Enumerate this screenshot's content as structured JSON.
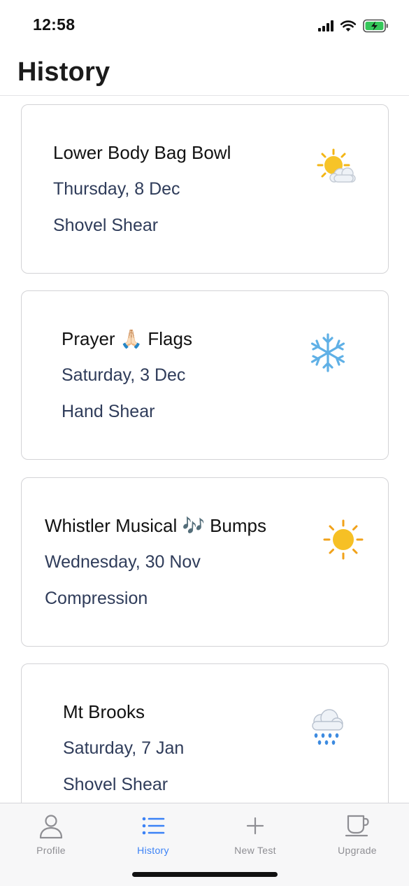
{
  "status": {
    "time": "12:58",
    "icons": [
      "cellular-signal-icon",
      "wifi-icon",
      "battery-charging-icon"
    ]
  },
  "header": {
    "title": "History"
  },
  "history": {
    "items": [
      {
        "title": "Lower Body Bag Bowl",
        "date": "Thursday, 8 Dec",
        "type": "Shovel Shear",
        "weather_icon": "sun-behind-cloud-icon"
      },
      {
        "title": "Prayer 🙏🏻 Flags",
        "date": "Saturday, 3 Dec",
        "type": "Hand Shear",
        "weather_icon": "snowflake-icon"
      },
      {
        "title": "Whistler Musical 🎶 Bumps",
        "date": "Wednesday, 30 Nov",
        "type": "Compression",
        "weather_icon": "sun-icon"
      },
      {
        "title": "Mt Brooks",
        "date": "Saturday, 7 Jan",
        "type": "Shovel Shear",
        "weather_icon": "cloud-with-rain-icon"
      }
    ]
  },
  "tabbar": {
    "tabs": [
      {
        "label": "Profile",
        "icon": "person-icon",
        "active": false
      },
      {
        "label": "History",
        "icon": "list-icon",
        "active": true
      },
      {
        "label": "New Test",
        "icon": "plus-icon",
        "active": false
      },
      {
        "label": "Upgrade",
        "icon": "coffee-cup-icon",
        "active": false
      }
    ]
  },
  "colors": {
    "accent": "#3b82f6",
    "secondary_text": "#2f3c5a",
    "tab_inactive": "#8e8e93"
  }
}
